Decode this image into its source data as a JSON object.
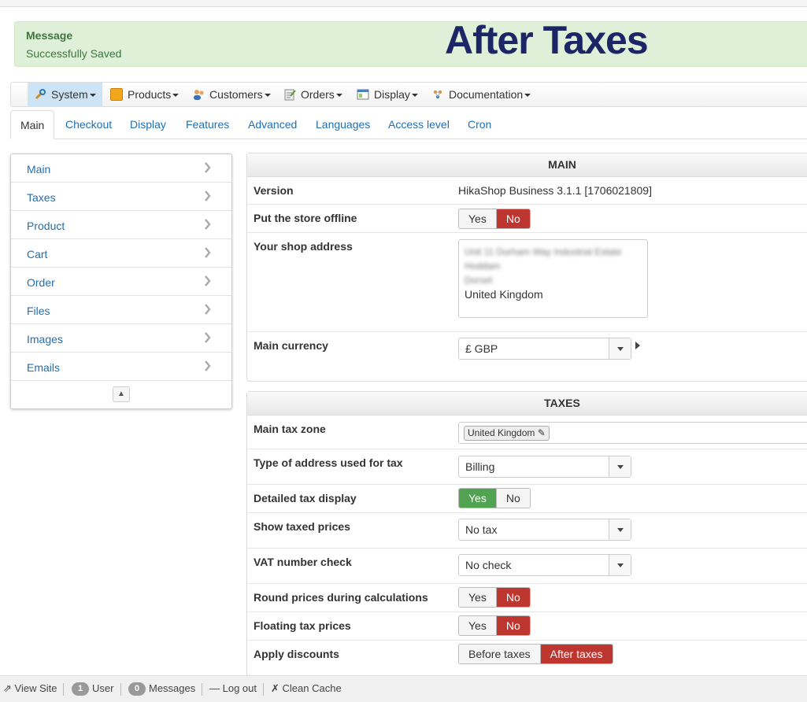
{
  "message": {
    "title": "Message",
    "text": "Successfully Saved"
  },
  "overlay_title": "After Taxes",
  "menu": [
    {
      "label": "System",
      "icon": "wrench-icon"
    },
    {
      "label": "Products",
      "icon": "box-icon"
    },
    {
      "label": "Customers",
      "icon": "users-icon"
    },
    {
      "label": "Orders",
      "icon": "clipboard-icon"
    },
    {
      "label": "Display",
      "icon": "window-icon"
    },
    {
      "label": "Documentation",
      "icon": "sparkle-icon"
    }
  ],
  "tabs": [
    "Main",
    "Checkout",
    "Display",
    "Features",
    "Advanced",
    "Languages",
    "Access level",
    "Cron"
  ],
  "sidenav": [
    "Main",
    "Taxes",
    "Product",
    "Cart",
    "Order",
    "Files",
    "Images",
    "Emails"
  ],
  "main_panel": {
    "header": "MAIN",
    "version_label": "Version",
    "version_value": "HikaShop Business 3.1.1 [1706021809]",
    "offline_label": "Put the store offline",
    "offline_yes": "Yes",
    "offline_no": "No",
    "address_label": "Your shop address",
    "address_lines_blurred": [
      "Unit 11 Durham Way Industrial Estate",
      "Hoddam",
      "Dorset"
    ],
    "address_country": "United Kingdom",
    "currency_label": "Main currency",
    "currency_value": "£ GBP"
  },
  "taxes_panel": {
    "header": "TAXES",
    "zone_label": "Main tax zone",
    "zone_value": "United Kingdom",
    "address_type_label": "Type of address used for tax",
    "address_type_value": "Billing",
    "detailed_label": "Detailed tax display",
    "detailed_yes": "Yes",
    "detailed_no": "No",
    "taxed_prices_label": "Show taxed prices",
    "taxed_prices_value": "No tax",
    "vat_label": "VAT number check",
    "vat_value": "No check",
    "round_label": "Round prices during calculations",
    "round_yes": "Yes",
    "round_no": "No",
    "floating_label": "Floating tax prices",
    "floating_yes": "Yes",
    "floating_no": "No",
    "discounts_label": "Apply discounts",
    "discounts_before": "Before taxes",
    "discounts_after": "After taxes"
  },
  "footer": {
    "view_site": "View Site",
    "user_count": "1",
    "user_label": "User",
    "messages_count": "0",
    "messages_label": "Messages",
    "logout": "Log out",
    "clean_cache": "Clean Cache"
  },
  "colors": {
    "link": "#1f6fb5",
    "active_red": "#bd362f",
    "active_green": "#51a351",
    "success_bg": "#dff0d8",
    "overlay": "#1c2566"
  }
}
